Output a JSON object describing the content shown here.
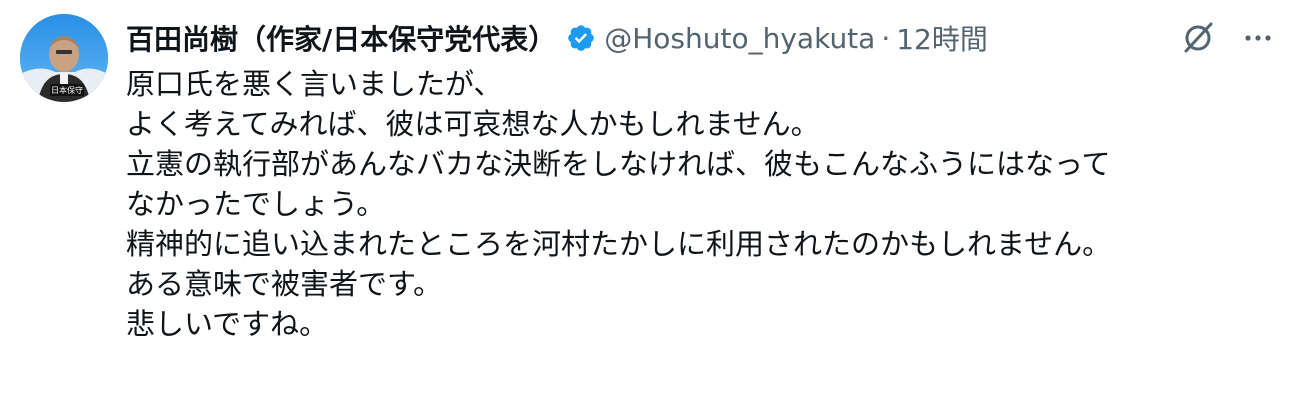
{
  "tweet": {
    "author": {
      "display_name": "百田尚樹（作家/日本保守党代表）",
      "verified": true,
      "verified_color": "#1d9bf0",
      "handle": "@Hoshuto_hyakuta",
      "separator": "·",
      "timestamp": "12時間",
      "avatar_icon": "profile-photo"
    },
    "actions": {
      "grok_icon": "grok-icon",
      "more_icon": "more-icon"
    },
    "body_lines": [
      "原口氏を悪く言いましたが、",
      "よく考えてみれば、彼は可哀想な人かもしれません。",
      "立憲の執行部があんなバカな決断をしなければ、彼もこんなふうにはなって",
      "なかったでしょう。",
      "精神的に追い込まれたところを河村たかしに利用されたのかもしれません。",
      "ある意味で被害者です。",
      "悲しいですね。"
    ]
  }
}
